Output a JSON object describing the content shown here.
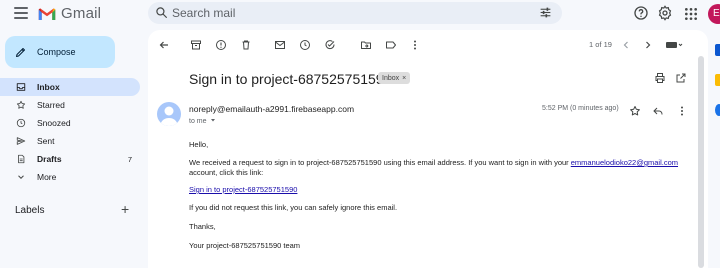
{
  "app": {
    "name": "Gmail"
  },
  "search": {
    "placeholder": "Search mail"
  },
  "account": {
    "avatar_letter": "E"
  },
  "compose": {
    "label": "Compose"
  },
  "sidebar": {
    "items": [
      {
        "label": "Inbox",
        "count": ""
      },
      {
        "label": "Starred",
        "count": ""
      },
      {
        "label": "Snoozed",
        "count": ""
      },
      {
        "label": "Sent",
        "count": ""
      },
      {
        "label": "Drafts",
        "count": "7"
      },
      {
        "label": "More",
        "count": ""
      }
    ],
    "labels_heading": "Labels"
  },
  "toolbar": {
    "pager": "1 of 19"
  },
  "email": {
    "subject": "Sign in to project-687525751590",
    "chip": "Inbox",
    "sender": "noreply@emailauth-a2991.firebaseapp.com",
    "to": "to me",
    "timestamp": "5:52 PM (0 minutes ago)",
    "greeting": "Hello,",
    "line1": "We received a request to sign in to project-687525751590 using this email address. If you want to sign in with your",
    "email_link": "emmanuelodioko22@gmail.com",
    "line1b": "account, click this link:",
    "signin_link": "Sign in to project-687525751590",
    "ignore_line": "If you did not request this link, you can safely ignore this email.",
    "thanks": "Thanks,",
    "signature": "Your project-687525751590 team"
  },
  "colors": {
    "accent": "#0b57d0",
    "compose_bg": "#c2e7ff",
    "active_nav_bg": "#d3e3fd",
    "avatar": "#c2185b"
  }
}
